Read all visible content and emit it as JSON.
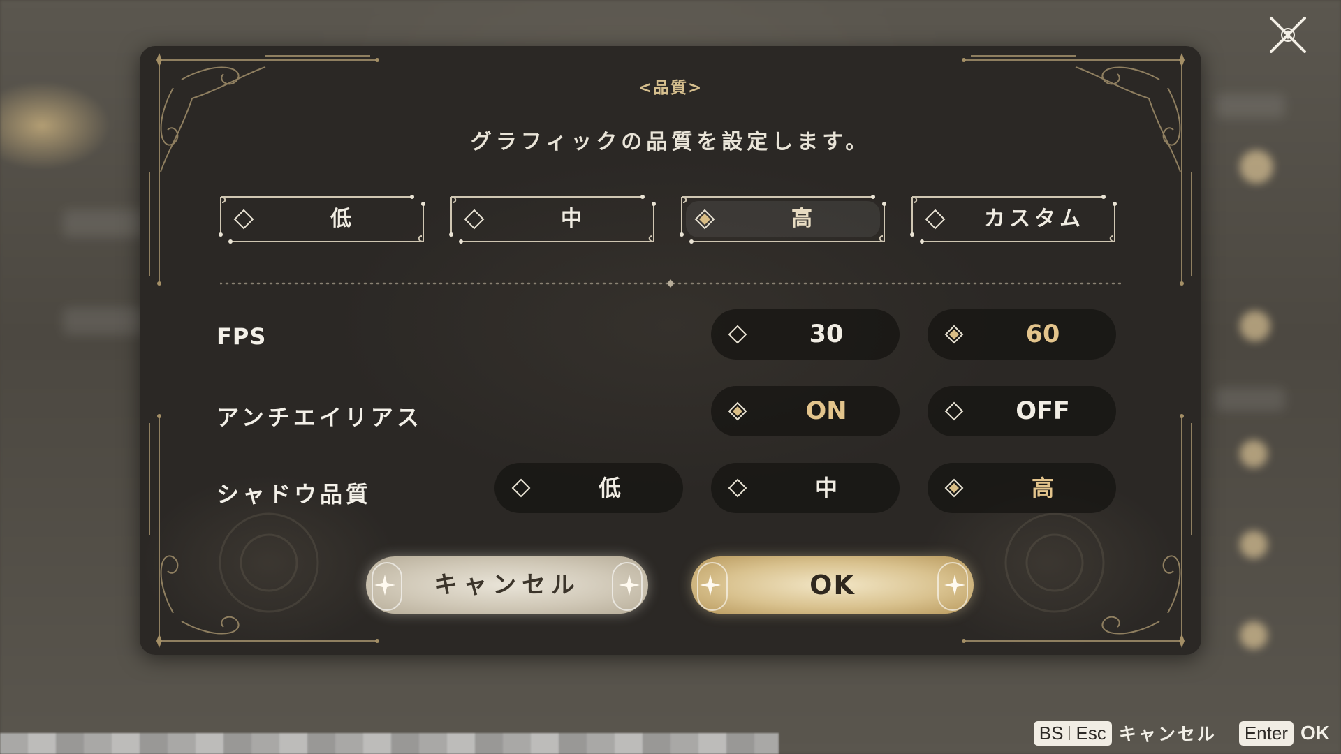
{
  "dialog": {
    "title": "<品質>",
    "description": "グラフィックの品質を設定します。"
  },
  "presets": [
    {
      "label": "低",
      "selected": false
    },
    {
      "label": "中",
      "selected": false
    },
    {
      "label": "高",
      "selected": true
    },
    {
      "label": "カスタム",
      "selected": false
    }
  ],
  "settings": {
    "fps": {
      "label": "FPS",
      "options": [
        {
          "label": "30",
          "selected": false
        },
        {
          "label": "60",
          "selected": true
        }
      ]
    },
    "antialias": {
      "label": "アンチエイリアス",
      "options": [
        {
          "label": "ON",
          "selected": true
        },
        {
          "label": "OFF",
          "selected": false
        }
      ]
    },
    "shadow": {
      "label": "シャドウ品質",
      "options": [
        {
          "label": "低",
          "selected": false
        },
        {
          "label": "中",
          "selected": false
        },
        {
          "label": "高",
          "selected": true
        }
      ]
    }
  },
  "actions": {
    "cancel_label": "キャンセル",
    "ok_label": "OK"
  },
  "hints": {
    "cancel_key_1": "BS",
    "cancel_key_2": "Esc",
    "cancel_text": "キャンセル",
    "ok_key": "Enter",
    "ok_text": "OK"
  },
  "colors": {
    "accent_gold": "#e3c48c",
    "dialog_bg": "#2b2825",
    "text_light": "#f1ede4"
  }
}
